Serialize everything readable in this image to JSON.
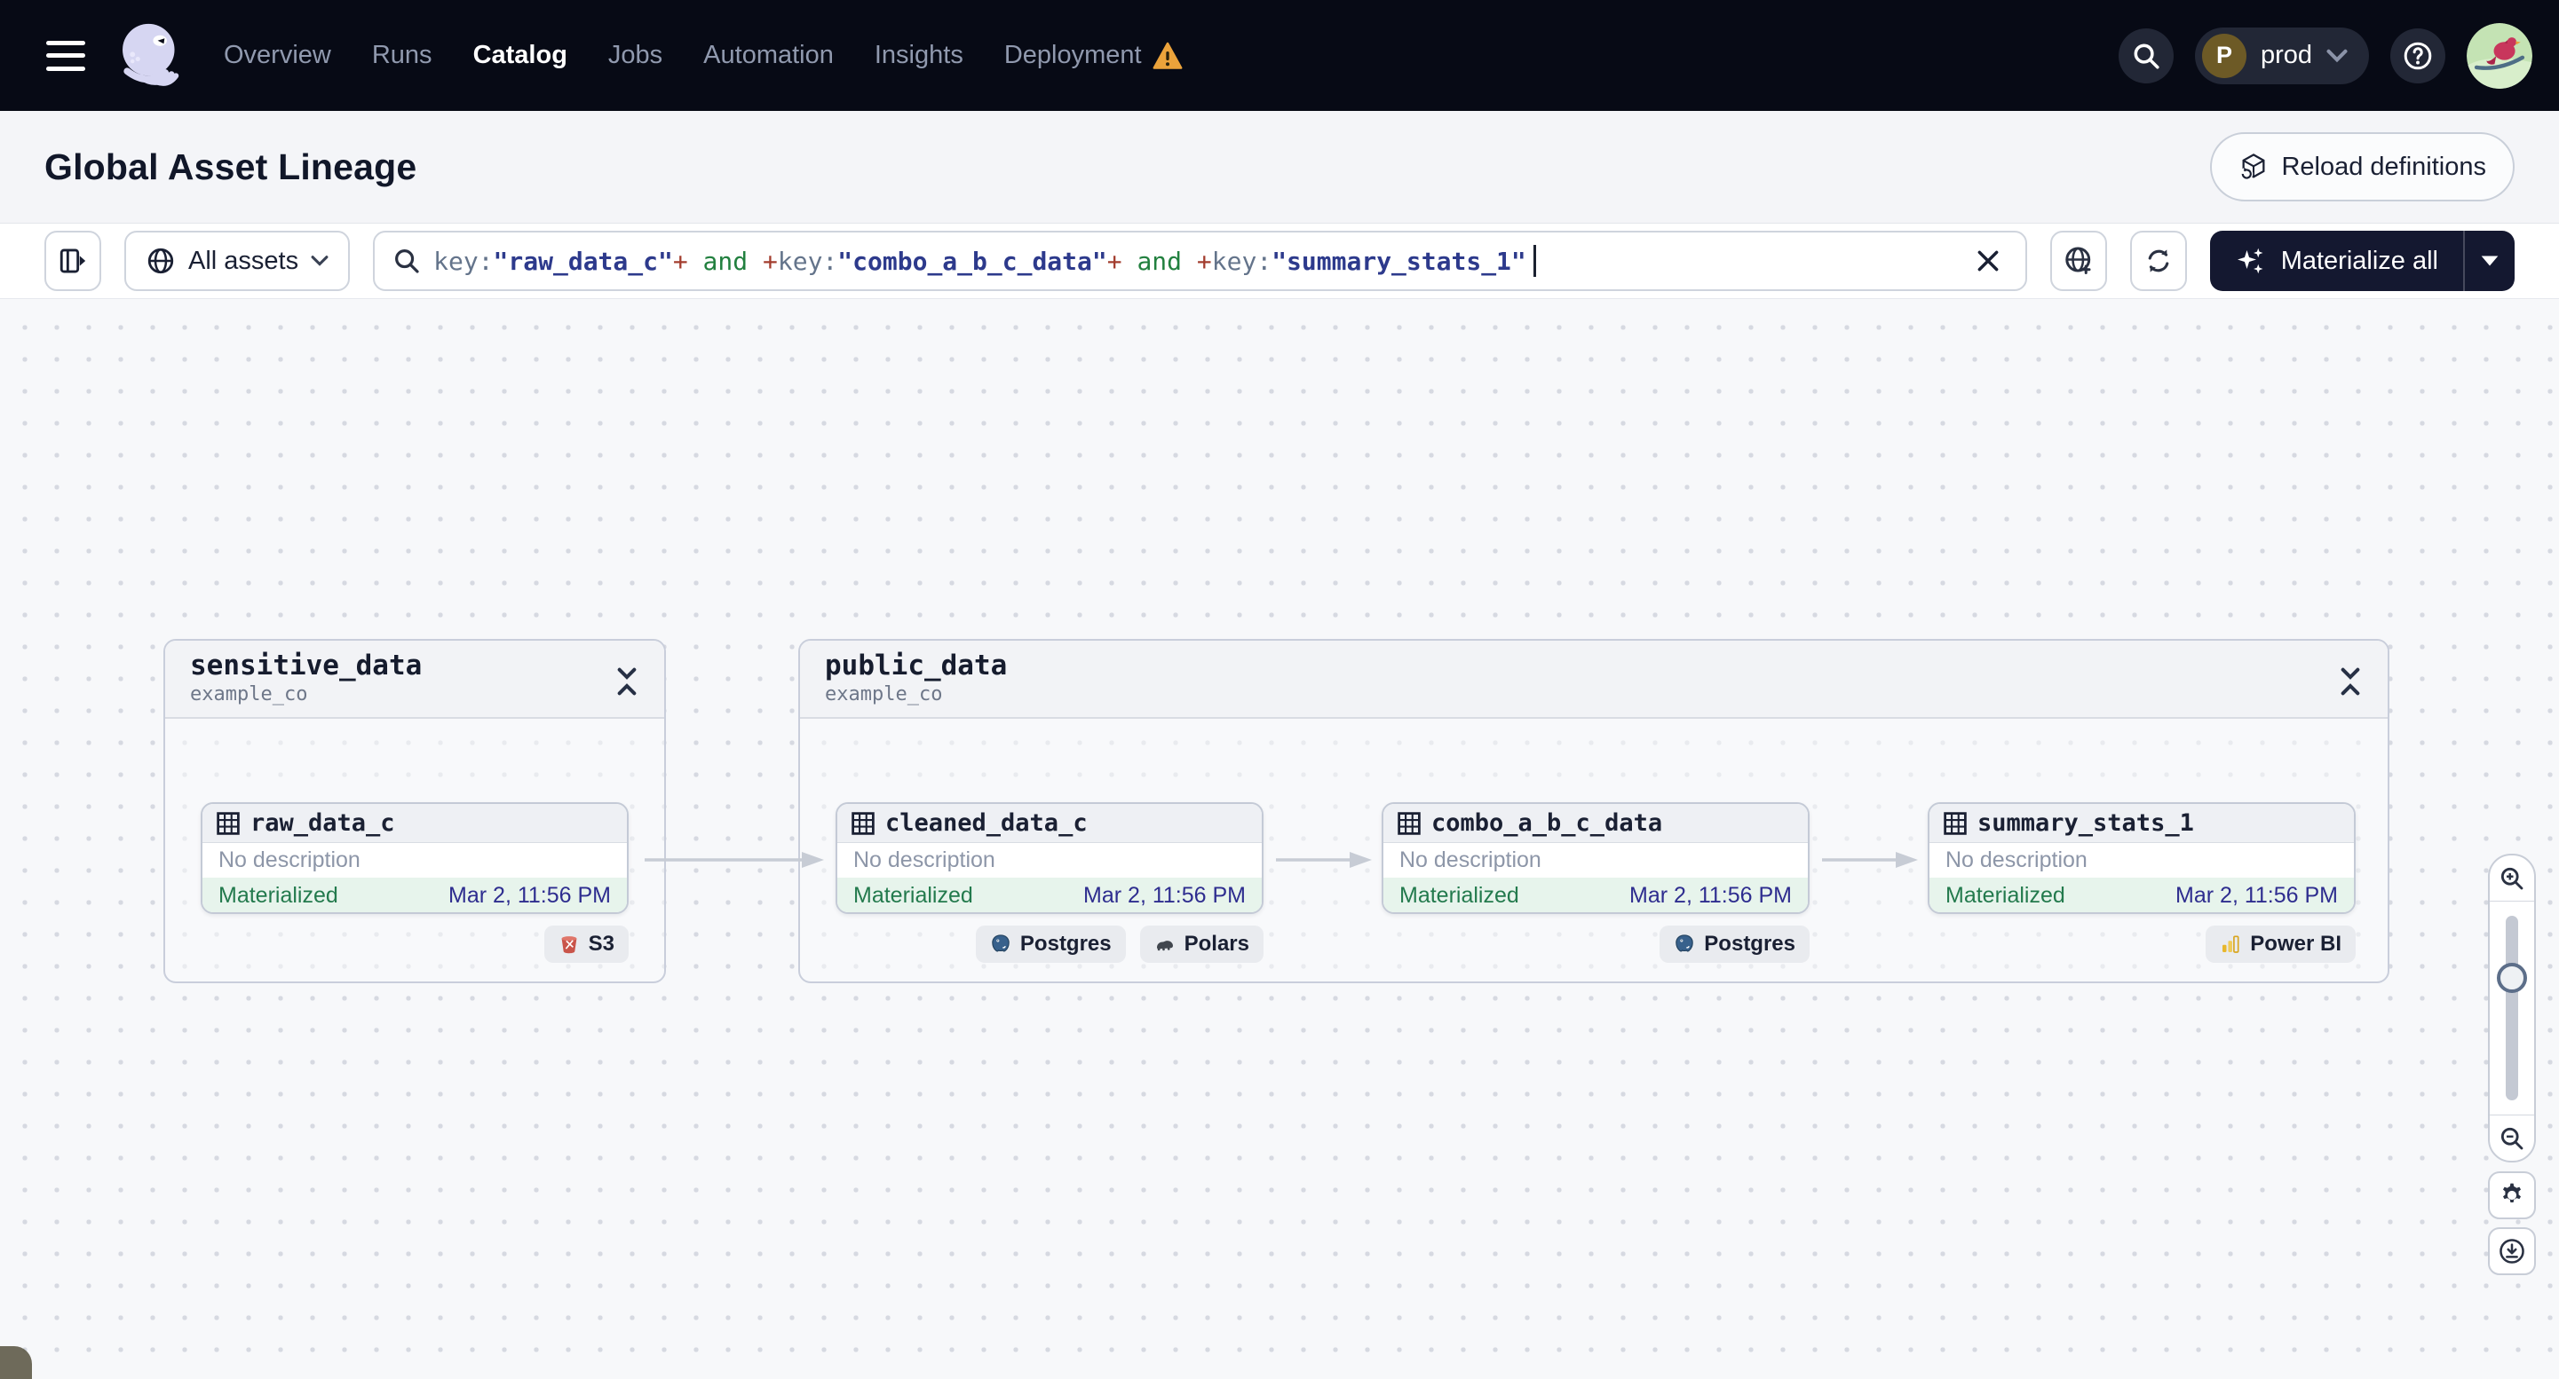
{
  "nav": {
    "items": [
      {
        "label": "Overview",
        "active": false
      },
      {
        "label": "Runs",
        "active": false
      },
      {
        "label": "Catalog",
        "active": true
      },
      {
        "label": "Jobs",
        "active": false
      },
      {
        "label": "Automation",
        "active": false
      },
      {
        "label": "Insights",
        "active": false
      },
      {
        "label": "Deployment",
        "active": false,
        "warning": true
      }
    ],
    "env_badge": {
      "initial": "P",
      "name": "prod"
    }
  },
  "page": {
    "title": "Global Asset Lineage",
    "reload_definitions_label": "Reload definitions"
  },
  "toolbar": {
    "scope_selector_label": "All assets",
    "search": {
      "tokens": [
        {
          "text": "key:"
        },
        {
          "text": "\"raw_data_c\""
        },
        {
          "text": "+"
        },
        {
          "text": " and "
        },
        {
          "text": "+"
        },
        {
          "text": "key:"
        },
        {
          "text": "\"combo_a_b_c_data\""
        },
        {
          "text": "+"
        },
        {
          "text": " and "
        },
        {
          "text": "+"
        },
        {
          "text": "key:"
        },
        {
          "text": "\"summary_stats_1\""
        }
      ]
    },
    "materialize_all_label": "Materialize all"
  },
  "graph": {
    "groups": [
      {
        "name": "sensitive_data",
        "location": "example_co"
      },
      {
        "name": "public_data",
        "location": "example_co"
      }
    ],
    "nodes": [
      {
        "name": "raw_data_c",
        "description": "No description",
        "status": "Materialized",
        "timestamp": "Mar 2, 11:56 PM",
        "tags": [
          {
            "label": "S3"
          }
        ]
      },
      {
        "name": "cleaned_data_c",
        "description": "No description",
        "status": "Materialized",
        "timestamp": "Mar 2, 11:56 PM",
        "tags": [
          {
            "label": "Postgres"
          },
          {
            "label": "Polars"
          }
        ]
      },
      {
        "name": "combo_a_b_c_data",
        "description": "No description",
        "status": "Materialized",
        "timestamp": "Mar 2, 11:56 PM",
        "tags": [
          {
            "label": "Postgres"
          }
        ]
      },
      {
        "name": "summary_stats_1",
        "description": "No description",
        "status": "Materialized",
        "timestamp": "Mar 2, 11:56 PM",
        "tags": [
          {
            "label": "Power BI"
          }
        ]
      }
    ]
  },
  "colors": {
    "nav_bg": "#070a15",
    "status_green": "#237a4d",
    "timestamp_blue": "#2e2d8f",
    "warning_orange": "#eba33b",
    "accent_dark_button": "#141830"
  }
}
